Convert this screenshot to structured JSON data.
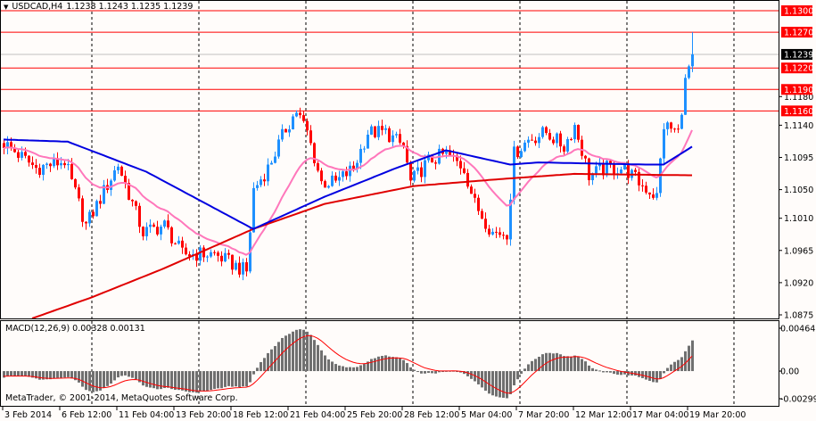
{
  "header": {
    "symbol": "USDCAD,H4",
    "ohlc": "1.1238 1.1243 1.1235 1.1239"
  },
  "colors": {
    "bull": "#1e90ff",
    "bear": "#ff0000",
    "ma_fast": "#ff77bb",
    "ma_mid": "#0000e0",
    "ma_slow": "#e00000",
    "level": "#ff0000",
    "bg": "#fffcfa"
  },
  "price_axis": {
    "range": [
      1.0875,
      1.13
    ],
    "ticks": [
      "1.1180",
      "1.1140",
      "1.1095",
      "1.1050",
      "1.1010",
      "1.0965",
      "1.0920",
      "1.0875"
    ],
    "levels": [
      "1.1300",
      "1.1270",
      "1.1220",
      "1.1190",
      "1.1160"
    ],
    "current": "1.1239"
  },
  "time_axis": {
    "bars_per_label": 16,
    "labels": [
      "3 Feb 2014",
      "6 Feb 12:00",
      "11 Feb 04:00",
      "13 Feb 20:00",
      "18 Feb 12:00",
      "21 Feb 04:00",
      "25 Feb 20:00",
      "28 Feb 12:00",
      "5 Mar 04:00",
      "7 Mar 20:00",
      "12 Mar 12:00",
      "17 Mar 04:00",
      "19 Mar 20:00"
    ]
  },
  "macd": {
    "label": "MACD(12,26,9) 0.00328 0.00131",
    "range": [
      -0.00299,
      0.00464
    ],
    "ticks": [
      "0.00464",
      "0.00",
      "-0.00299"
    ]
  },
  "footer": {
    "copyright": "MetaTrader, © 2001-2014, MetaQuotes Software Corp."
  },
  "chart_data": {
    "type": "candlestick",
    "bars": 194,
    "close_keyframes": [
      [
        0,
        1.1115
      ],
      [
        9,
        1.108
      ],
      [
        17,
        1.109
      ],
      [
        23,
        1.1
      ],
      [
        32,
        1.1085
      ],
      [
        39,
        1.099
      ],
      [
        45,
        1.1
      ],
      [
        50,
        1.096
      ],
      [
        59,
        1.096
      ],
      [
        68,
        1.0935
      ],
      [
        70,
        1.105
      ],
      [
        74,
        1.108
      ],
      [
        79,
        1.1135
      ],
      [
        82,
        1.116
      ],
      [
        85,
        1.113
      ],
      [
        89,
        1.106
      ],
      [
        93,
        1.106
      ],
      [
        98,
        1.108
      ],
      [
        102,
        1.113
      ],
      [
        107,
        1.113
      ],
      [
        112,
        1.111
      ],
      [
        114,
        1.106
      ],
      [
        119,
        1.109
      ],
      [
        124,
        1.11
      ],
      [
        129,
        1.108
      ],
      [
        132,
        1.103
      ],
      [
        137,
        1.099
      ],
      [
        141,
        1.099
      ],
      [
        143,
        1.11
      ],
      [
        147,
        1.112
      ],
      [
        152,
        1.113
      ],
      [
        157,
        1.111
      ],
      [
        160,
        1.114
      ],
      [
        164,
        1.107
      ],
      [
        169,
        1.108
      ],
      [
        174,
        1.108
      ],
      [
        178,
        1.106
      ],
      [
        183,
        1.104
      ],
      [
        185,
        1.114
      ],
      [
        189,
        1.113
      ],
      [
        191,
        1.12
      ],
      [
        193,
        1.1239
      ]
    ],
    "ma_blue_keyframes": [
      [
        0,
        1.112
      ],
      [
        18,
        1.1117
      ],
      [
        40,
        1.1075
      ],
      [
        70,
        1.0995
      ],
      [
        90,
        1.104
      ],
      [
        110,
        1.108
      ],
      [
        124,
        1.1105
      ],
      [
        142,
        1.1085
      ],
      [
        150,
        1.1088
      ],
      [
        180,
        1.1085
      ],
      [
        185,
        1.1085
      ],
      [
        193,
        1.111
      ]
    ],
    "ma_red_keyframes": [
      [
        8,
        1.087
      ],
      [
        25,
        1.09
      ],
      [
        45,
        1.094
      ],
      [
        70,
        1.0995
      ],
      [
        90,
        1.103
      ],
      [
        115,
        1.1055
      ],
      [
        140,
        1.1065
      ],
      [
        160,
        1.1072
      ],
      [
        193,
        1.107
      ]
    ],
    "last_high": 1.127
  }
}
